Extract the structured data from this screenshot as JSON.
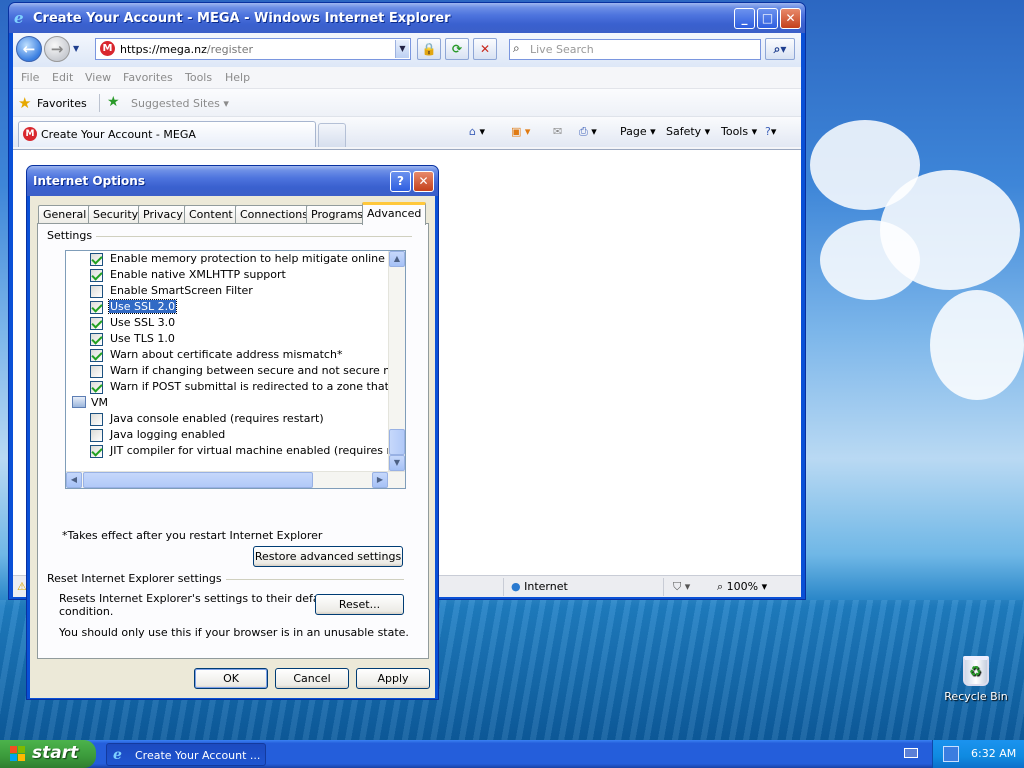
{
  "ie": {
    "title": "Create Your Account - MEGA - Windows Internet Explorer",
    "url_host": "https://mega.nz",
    "url_path": "/register",
    "search_placeholder": "Live Search",
    "menu": [
      "File",
      "Edit",
      "View",
      "Favorites",
      "Tools",
      "Help"
    ],
    "favorites_label": "Favorites",
    "suggested_sites": "Suggested Sites ▾",
    "tab_title": "Create Your Account - MEGA",
    "cmd_page": "Page ▾",
    "cmd_safety": "Safety ▾",
    "cmd_tools": "Tools ▾",
    "status_zone": "Internet",
    "zoom": "100%"
  },
  "dialog": {
    "title": "Internet Options",
    "tabs": [
      "General",
      "Security",
      "Privacy",
      "Content",
      "Connections",
      "Programs",
      "Advanced"
    ],
    "active_tab": "Advanced",
    "settings_label": "Settings",
    "items": [
      {
        "label": "Enable memory protection to help mitigate online attacks*",
        "checked": true
      },
      {
        "label": "Enable native XMLHTTP support",
        "checked": true
      },
      {
        "label": "Enable SmartScreen Filter",
        "checked": false
      },
      {
        "label": "Use SSL 2.0",
        "checked": true,
        "selected": true
      },
      {
        "label": "Use SSL 3.0",
        "checked": true
      },
      {
        "label": "Use TLS 1.0",
        "checked": true
      },
      {
        "label": "Warn about certificate address mismatch*",
        "checked": true
      },
      {
        "label": "Warn if changing between secure and not secure mode",
        "checked": false
      },
      {
        "label": "Warn if POST submittal is redirected to a zone that does n",
        "checked": true
      },
      {
        "label": "VM",
        "folder": true
      },
      {
        "label": "Java console enabled (requires restart)",
        "checked": false
      },
      {
        "label": "Java logging enabled",
        "checked": false
      },
      {
        "label": "JIT compiler for virtual machine enabled (requires restart)",
        "checked": true
      }
    ],
    "restart_note": "*Takes effect after you restart Internet Explorer",
    "restore_button": "Restore advanced settings",
    "reset_group_label": "Reset Internet Explorer settings",
    "reset_desc_line1": "Resets Internet Explorer's settings to their default",
    "reset_desc_line2": "condition.",
    "reset_button": "Reset...",
    "reset_warning": "You should only use this if your browser is in an unusable state.",
    "ok": "OK",
    "cancel": "Cancel",
    "apply": "Apply"
  },
  "desktop": {
    "recycle_bin": "Recycle Bin"
  },
  "taskbar": {
    "start": "start",
    "task": "Create Your Account ...",
    "time": "6:32 AM"
  },
  "colors": {
    "xp_blue": "#245edb",
    "selection": "#316ac5",
    "start_green": "#3b9a3b"
  }
}
